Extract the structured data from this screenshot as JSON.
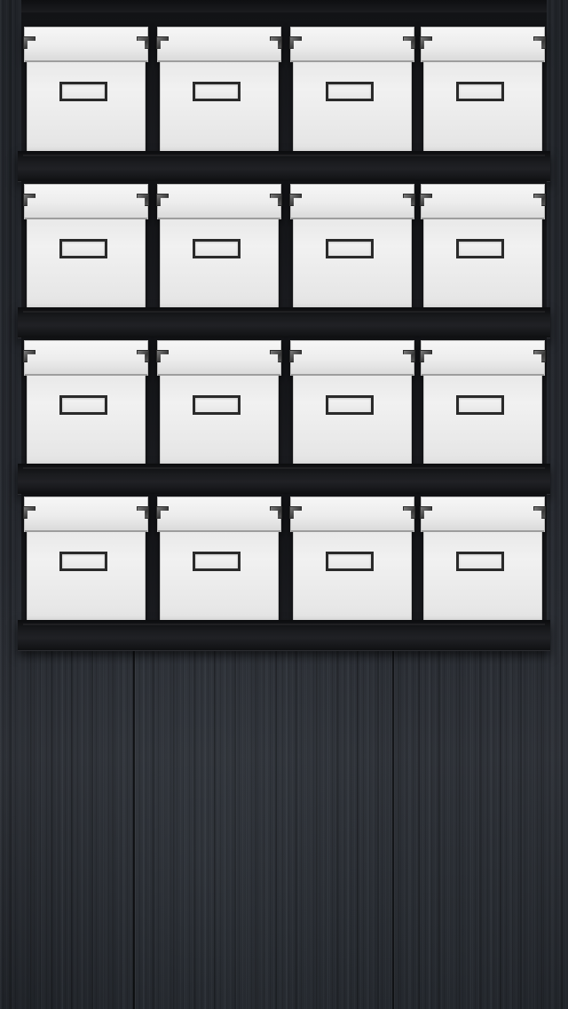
{
  "wallpaper": {
    "description_colors": {
      "wood": "#23262c",
      "shelf": "#141518",
      "box": "#eeeeee",
      "label_frame": "#2a2a2a"
    }
  },
  "shelves": [
    {
      "boxes": [
        {},
        {},
        {},
        {}
      ]
    },
    {
      "boxes": [
        {},
        {},
        {},
        {}
      ]
    },
    {
      "boxes": [
        {},
        {},
        {},
        {}
      ]
    },
    {
      "boxes": [
        {},
        {},
        {},
        {}
      ]
    }
  ]
}
